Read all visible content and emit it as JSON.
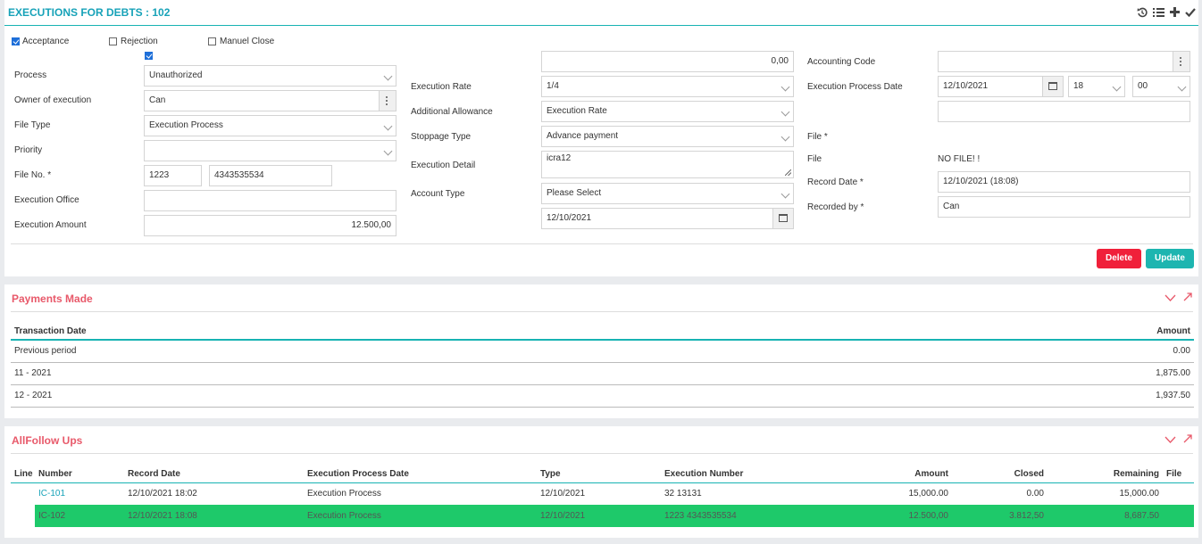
{
  "header": {
    "title": "EXECUTIONS FOR DEBTS : 102",
    "icons": [
      "history-icon",
      "list-icon",
      "plus-icon",
      "check-icon"
    ]
  },
  "form": {
    "checkboxes": [
      {
        "label": "Acceptance",
        "checked": true
      },
      {
        "label": "Rejection",
        "checked": false
      },
      {
        "label": "Manuel Close",
        "checked": false
      }
    ],
    "extra_checkbox_checked": true,
    "process": {
      "label": "Process",
      "value": "Unauthorized"
    },
    "owner": {
      "label": "Owner of execution",
      "value": "Can"
    },
    "file_type": {
      "label": "File Type",
      "value": "Execution Process"
    },
    "priority": {
      "label": "Priority",
      "value": ""
    },
    "file_no": {
      "label": "File No. *",
      "value1": "1223",
      "value2": "4343535534"
    },
    "execution_office": {
      "label": "Execution Office",
      "value": ""
    },
    "execution_amount": {
      "label": "Execution Amount",
      "value": "12.500,00"
    },
    "top_amount": {
      "value": "0,00"
    },
    "execution_rate": {
      "label": "Execution Rate",
      "value": "1/4"
    },
    "additional_allowance": {
      "label": "Additional Allowance",
      "value": "Execution Rate"
    },
    "stoppage_type": {
      "label": "Stoppage Type",
      "value": "Advance payment"
    },
    "execution_detail": {
      "label": "Execution Detail",
      "value": "icra12"
    },
    "account_type": {
      "label": "Account Type",
      "value": "Please Select"
    },
    "mid_date": {
      "value": "12/10/2021"
    },
    "accounting_code": {
      "label": "Accounting Code",
      "value": ""
    },
    "execution_process_date": {
      "label": "Execution Process Date",
      "date": "12/10/2021",
      "hour": "18",
      "minute": "00"
    },
    "blank_field": {
      "value": ""
    },
    "file_required": {
      "label": "File *"
    },
    "file": {
      "label": "File",
      "value": "NO FILE! !"
    },
    "record_date": {
      "label": "Record Date *",
      "value": "12/10/2021 (18:08)"
    },
    "recorded_by": {
      "label": "Recorded by *",
      "value": "Can"
    },
    "buttons": {
      "delete": "Delete",
      "update": "Update"
    },
    "colors": {
      "delete": "#f0203a",
      "update": "#1db5b0",
      "accent": "#17a2b8"
    }
  },
  "payments": {
    "title": "Payments Made",
    "columns": {
      "date": "Transaction Date",
      "amount": "Amount"
    },
    "rows": [
      {
        "date": "Previous period",
        "amount": "0.00"
      },
      {
        "date": "11 - 2021",
        "amount": "1,875.00"
      },
      {
        "date": "12 - 2021",
        "amount": "1,937.50"
      }
    ]
  },
  "followups": {
    "title": "AllFollow Ups",
    "columns": {
      "line": "Line",
      "number": "Number",
      "record_date": "Record Date",
      "exec_date": "Execution Process Date",
      "type": "Type",
      "exec_number": "Execution Number",
      "amount": "Amount",
      "closed": "Closed",
      "remaining": "Remaining",
      "file": "File"
    },
    "rows": [
      {
        "number": "IC-101",
        "record_date": "12/10/2021 18:02",
        "exec_date": "Execution Process",
        "type": "12/10/2021",
        "exec_number": "32 13131",
        "amount": "15,000.00",
        "closed": "0.00",
        "remaining": "15,000.00",
        "highlight": false
      },
      {
        "number": "IC-102",
        "record_date": "12/10/2021 18:08",
        "exec_date": "Execution Process",
        "type": "12/10/2021",
        "exec_number": "1223 4343535534",
        "amount": "12.500,00",
        "closed": "3.812,50",
        "remaining": "8,687.50",
        "highlight": true
      }
    ],
    "highlight_color": "#1ec96a"
  }
}
